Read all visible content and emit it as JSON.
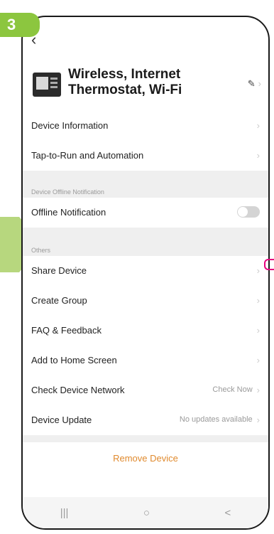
{
  "step_badge": "3",
  "device": {
    "name": "Wireless, Internet Thermostat, Wi-Fi"
  },
  "rows_top": [
    {
      "label": "Device Information"
    },
    {
      "label": "Tap-to-Run and Automation"
    }
  ],
  "section_offline": {
    "title": "Device Offline Notification",
    "row_label": "Offline Notification",
    "toggle_on": false
  },
  "section_others": {
    "title": "Others",
    "rows": [
      {
        "label": "Share Device",
        "value": ""
      },
      {
        "label": "Create Group",
        "value": ""
      },
      {
        "label": "FAQ & Feedback",
        "value": ""
      },
      {
        "label": "Add to Home Screen",
        "value": ""
      },
      {
        "label": "Check Device Network",
        "value": "Check Now"
      },
      {
        "label": "Device Update",
        "value": "No updates available"
      }
    ]
  },
  "remove": "Remove Device",
  "icons": {
    "back": "back-icon",
    "edit": "pencil-icon",
    "chevron": "chevron-right-icon"
  },
  "nav": {
    "recent": "|||",
    "home": "○",
    "back": "<"
  },
  "colors": {
    "badge": "#8cc63f",
    "arrow": "#b7d77e",
    "remove": "#e08a2e",
    "marker": "#e6007e"
  }
}
